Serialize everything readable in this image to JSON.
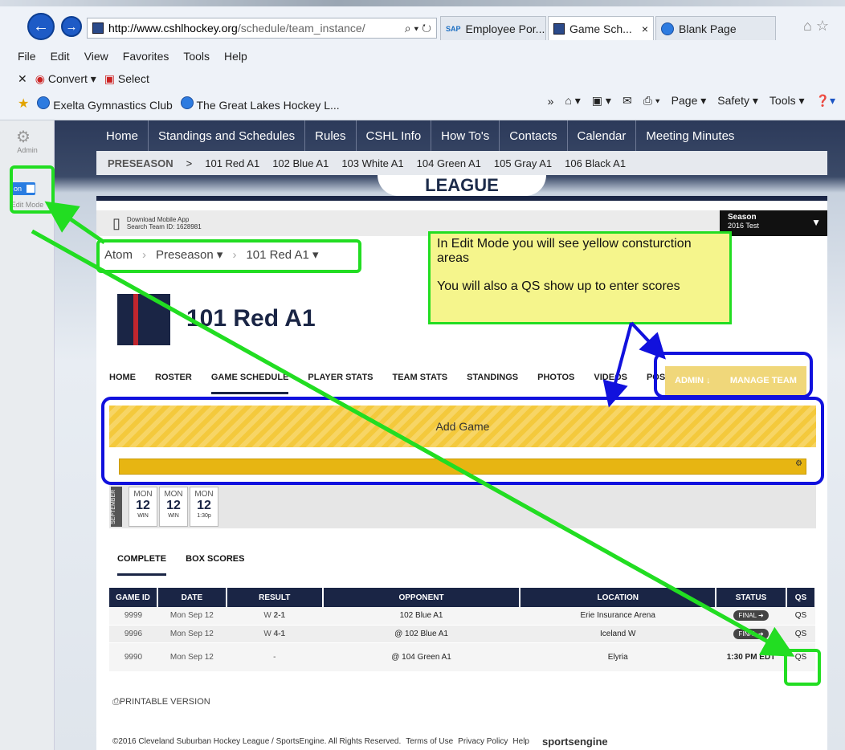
{
  "browser": {
    "url_domain": "http://www.cshlhockey.org",
    "url_path": "/schedule/team_instance/",
    "tabs": [
      {
        "label": "Employee Por..."
      },
      {
        "label": "Game Sch..."
      },
      {
        "label": "Blank Page"
      }
    ],
    "menu": [
      "File",
      "Edit",
      "View",
      "Favorites",
      "Tools",
      "Help"
    ],
    "commands": {
      "convert": "Convert",
      "select": "Select"
    },
    "favorites": [
      "Exelta Gymnastics Club",
      "The Great Lakes Hockey L..."
    ],
    "right_commands": [
      "Page",
      "Safety",
      "Tools"
    ]
  },
  "admin_sidebar": {
    "admin_label": "Admin",
    "toggle_label": "on",
    "edit_mode_label": "Edit Mode"
  },
  "site_nav": [
    "Home",
    "Standings and Schedules",
    "Rules",
    "CSHL Info",
    "How To's",
    "Contacts",
    "Calendar",
    "Meeting Minutes"
  ],
  "subnav": {
    "selected": "PRESEASON",
    "items": [
      "101 Red A1",
      "102 Blue A1",
      "103 White A1",
      "104 Green A1",
      "105 Gray A1",
      "106 Black A1"
    ]
  },
  "league_banner": "LEAGUE",
  "app_row": {
    "line1": "Download Mobile App",
    "line2": "Search Team ID: 1628981"
  },
  "season": {
    "label": "Season",
    "value": "2016 Test"
  },
  "breadcrumb": [
    "Atom",
    "Preseason",
    "101 Red A1"
  ],
  "team_name": "101 Red A1",
  "team_tabs": [
    "HOME",
    "ROSTER",
    "GAME SCHEDULE",
    "PLAYER STATS",
    "TEAM STATS",
    "STANDINGS",
    "PHOTOS",
    "VIDEOS",
    "POST"
  ],
  "admin_tabs": [
    "ADMIN ↓",
    "MANAGE TEAM"
  ],
  "add_game_label": "Add Game",
  "month_label": "SEPTEMBER",
  "day_cards": [
    {
      "dow": "MON",
      "day": "12",
      "sub": "WIN"
    },
    {
      "dow": "MON",
      "day": "12",
      "sub": "WIN"
    },
    {
      "dow": "MON",
      "day": "12",
      "sub": "1:30p"
    }
  ],
  "sub_tabs": [
    "COMPLETE",
    "BOX SCORES"
  ],
  "table": {
    "headers": [
      "GAME ID",
      "DATE",
      "RESULT",
      "OPPONENT",
      "LOCATION",
      "STATUS",
      "QS"
    ],
    "rows": [
      {
        "id": "9999",
        "date": "Mon Sep 12",
        "result_letter": "W",
        "result_score": "2-1",
        "opponent": "102 Blue A1",
        "location": "Erie Insurance Arena",
        "status": "FINAL",
        "qs": "QS"
      },
      {
        "id": "9996",
        "date": "Mon Sep 12",
        "result_letter": "W",
        "result_score": "4-1",
        "opponent": "@ 102 Blue A1",
        "location": "Iceland W",
        "status": "FINAL",
        "qs": "QS"
      },
      {
        "id": "9990",
        "date": "Mon Sep 12",
        "result_letter": "-",
        "result_score": "",
        "opponent": "@ 104 Green A1",
        "location": "Elyria",
        "status": "1:30 PM EDT",
        "qs": "QS"
      }
    ]
  },
  "printable_label": "PRINTABLE VERSION",
  "footer": {
    "copyright": "©2016 Cleveland Suburban Hockey League / SportsEngine. All Rights Reserved.",
    "terms": "Terms of Use",
    "privacy": "Privacy Policy",
    "help": "Help",
    "brand": "sportsengine"
  },
  "annotation": {
    "line1": "In Edit Mode you will see yellow consturction areas",
    "line2": "You will also a QS show up to enter scores"
  },
  "colors": {
    "annotation_green": "#22dd22",
    "annotation_blue": "#1111dd",
    "navy": "#1a2545",
    "construction_yellow": "#f4c93c"
  }
}
